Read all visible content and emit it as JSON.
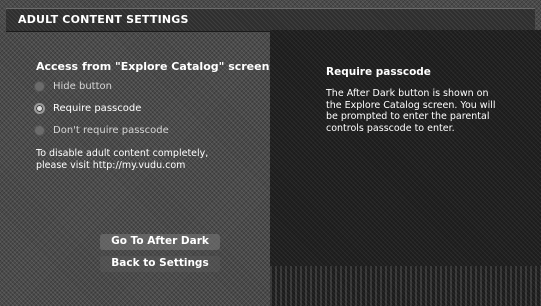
{
  "header": {
    "title": "ADULT CONTENT SETTINGS"
  },
  "left": {
    "section_title": "Access from \"Explore Catalog\" screen",
    "options": [
      {
        "label": "Hide button",
        "selected": false
      },
      {
        "label": "Require passcode",
        "selected": true
      },
      {
        "label": "Don't require passcode",
        "selected": false
      }
    ],
    "note": "To disable adult content completely,\nplease visit http://my.vudu.com"
  },
  "right": {
    "title": "Require passcode",
    "description": "The After Dark button is shown on the Explore Catalog screen. You will be prompted to enter the parental controls passcode to enter."
  },
  "buttons": {
    "after_dark": "Go To After Dark",
    "back": "Back to Settings"
  }
}
